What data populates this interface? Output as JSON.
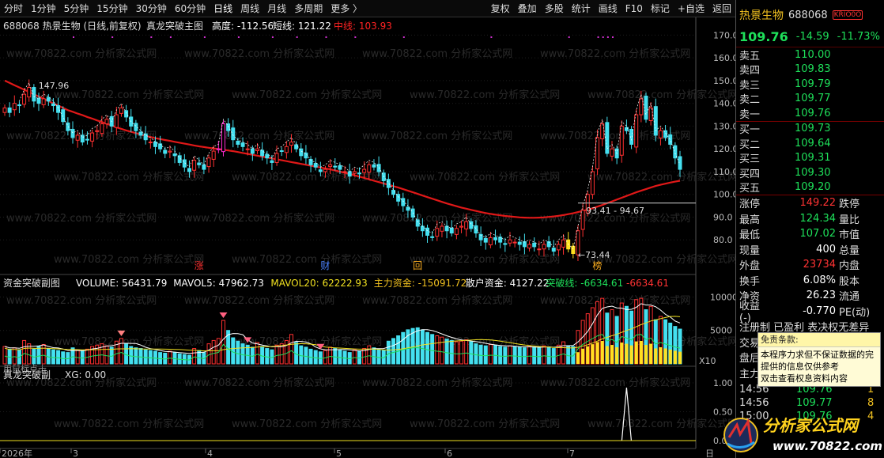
{
  "toolbar": {
    "left": [
      "分时",
      "1分钟",
      "5分钟",
      "15分钟",
      "30分钟",
      "60分钟",
      "日线",
      "周线",
      "月线",
      "多周期",
      "更多 〉"
    ],
    "active": "日线",
    "right": [
      "复权",
      "叠加",
      "多股",
      "统计",
      "画线",
      "F10",
      "标记",
      "+自选",
      "返回"
    ]
  },
  "main": {
    "title": "688068 热景生物 (日线,前复权)",
    "indicator": "真龙突破主图",
    "vals": [
      {
        "k": "高度",
        "v": "-112.56",
        "color": "#ffffff"
      },
      {
        "k": "短线",
        "v": "121.22",
        "color": "#ffffff"
      },
      {
        "k": "中线",
        "v": "103.93",
        "color": "#ff2222"
      }
    ],
    "y_ticks": [
      "170.0",
      "160.0",
      "150.0",
      "140.0",
      "130.0",
      "120.0",
      "110.0",
      "100.0",
      "90.0",
      "80.0"
    ],
    "labels": {
      "high": "147.96",
      "low": "73.44",
      "mid1": "93.41",
      "mid2": "94.67"
    },
    "markers": [
      "涨",
      "财",
      "回",
      "榜"
    ]
  },
  "sub1": {
    "title": "资金突破副图",
    "vals": [
      {
        "k": "VOLUME",
        "v": "56431.79",
        "color": "#ffffff"
      },
      {
        "k": "MAVOL5",
        "v": "47962.73",
        "color": "#ffffff"
      },
      {
        "k": "MAVOL20",
        "v": "62222.93",
        "color": "#f0e020"
      },
      {
        "k": "主力资金",
        "v": "-15091.72",
        "color": "#f0c020"
      },
      {
        "k": "散户资金",
        "v": "4127.22",
        "color": "#ffffff"
      },
      {
        "k": "突破线",
        "v": "-6634.61",
        "color": "#1ee05a"
      },
      {
        "k": "",
        "v": "-6634.61",
        "color": "#ff3333"
      }
    ],
    "y_ticks": [
      "10000",
      "5000",
      "X10"
    ],
    "corner": "用鼠标点击"
  },
  "sub2": {
    "title": "真龙突破副",
    "val": "XG: 0.00",
    "y_ticks": [
      "1.00",
      "0.50",
      "0.00"
    ]
  },
  "xaxis": {
    "labels": [
      "2026年",
      "3",
      "4",
      "5",
      "6",
      "7"
    ],
    "right": "日"
  },
  "watermark": "www.70822.com 分析家公式网",
  "chart_data": {
    "type": "candlestick",
    "closes": [
      138,
      136,
      140,
      139,
      144,
      147,
      141,
      140,
      142,
      141,
      139,
      136,
      132,
      128,
      125,
      126,
      123,
      124,
      127,
      128,
      131,
      133,
      130,
      135,
      138,
      134,
      130,
      128,
      126,
      124,
      123,
      121,
      120,
      118,
      119,
      117,
      114,
      112,
      110,
      115,
      113,
      111,
      116,
      119,
      120,
      131,
      128,
      124,
      122,
      121,
      120,
      118,
      120,
      117,
      116,
      114,
      118,
      119,
      121,
      123,
      120,
      117,
      116,
      113,
      112,
      110,
      111,
      113,
      112,
      111,
      110,
      108,
      110,
      109,
      111,
      113,
      112,
      110,
      106,
      103,
      100,
      97,
      95,
      93,
      90,
      86,
      84,
      82,
      81,
      85,
      86,
      84,
      83,
      85,
      86,
      88,
      85,
      83,
      80,
      79,
      81,
      80,
      79,
      78,
      80,
      79,
      78,
      77,
      78,
      77,
      76,
      78,
      77,
      75,
      78,
      80,
      76,
      74,
      84,
      93,
      100,
      110,
      125,
      131,
      118,
      120,
      116,
      130,
      128,
      122,
      135,
      142,
      133,
      138,
      126,
      128,
      125,
      122,
      116,
      111
    ],
    "ma_mid": [
      150,
      149,
      148,
      147,
      146,
      145,
      144,
      143,
      142,
      141,
      140,
      139,
      138,
      137,
      136.3,
      135.5,
      134.8,
      134,
      133.3,
      132.5,
      131.8,
      131,
      130.3,
      129.5,
      128.8,
      128.1,
      127.5,
      126.9,
      126.3,
      125.7,
      125.2,
      124.7,
      124.3,
      123.9,
      123.5,
      123.1,
      122.7,
      122.3,
      121.9,
      121.5,
      121.1,
      120.8,
      120.5,
      120.2,
      119.9,
      119.6,
      119.3,
      119,
      118.6,
      118.2,
      117.8,
      117.4,
      117,
      116.6,
      116.2,
      115.8,
      115.4,
      115,
      114.6,
      114.2,
      113.8,
      113.4,
      113,
      112.6,
      112.2,
      111.8,
      111.4,
      111,
      110.5,
      110,
      109.5,
      109,
      108.4,
      107.8,
      107.2,
      106.6,
      106,
      105.4,
      104.8,
      104.2,
      103.6,
      103,
      102.3,
      101.6,
      100.9,
      100.2,
      99.5,
      98.8,
      98.1,
      97.4,
      96.7,
      96,
      95.4,
      94.8,
      94.2,
      93.7,
      93.2,
      92.7,
      92.2,
      91.8,
      91.4,
      91.1,
      90.8,
      90.5,
      90.3,
      90.1,
      89.9,
      89.8,
      89.7,
      89.7,
      89.8,
      89.9,
      90.1,
      90.3,
      90.6,
      90.9,
      91.3,
      91.7,
      92.2,
      92.7,
      93.3,
      93.9,
      94.6,
      95.3,
      96.1,
      96.9,
      97.7,
      98.5,
      99.3,
      100.1,
      100.9,
      101.6,
      102.3,
      103,
      103.7,
      104.2,
      104.7,
      105.2,
      105.6,
      106
    ],
    "volume": [
      2600,
      2200,
      2400,
      2100,
      3500,
      3000,
      2200,
      2600,
      2900,
      2300,
      2100,
      2000,
      1800,
      1700,
      2400,
      2100,
      1900,
      2200,
      2600,
      2800,
      3000,
      2700,
      2500,
      3400,
      3800,
      3000,
      2600,
      2400,
      2300,
      2100,
      2000,
      1900,
      1700,
      1600,
      1900,
      1700,
      1500,
      1400,
      1300,
      2300,
      2000,
      1700,
      3000,
      3500,
      3800,
      6500,
      5000,
      3900,
      3400,
      3000,
      2800,
      2500,
      3200,
      2600,
      2300,
      2100,
      2800,
      3000,
      3500,
      4400,
      3200,
      2700,
      2500,
      2200,
      2000,
      1800,
      2000,
      2500,
      2300,
      2100,
      1900,
      1700,
      2100,
      1900,
      2300,
      2700,
      2400,
      2100,
      2000,
      3400,
      3800,
      4200,
      4700,
      5100,
      5300,
      5400,
      5100,
      4700,
      4400,
      4200,
      4000,
      3700,
      3500,
      3300,
      3400,
      3600,
      3300,
      3000,
      2800,
      2700,
      2900,
      2800,
      2600,
      2500,
      2700,
      2600,
      2500,
      2400,
      2600,
      2500,
      2400,
      2700,
      2500,
      2300,
      2800,
      3300,
      2700,
      2600,
      5000,
      6500,
      7500,
      8400,
      9300,
      9800,
      7600,
      8100,
      7100,
      9100,
      8600,
      7900,
      9600,
      9800,
      8100,
      8600,
      6600,
      7100,
      6600,
      6100,
      5600,
      5200
    ],
    "xg_signal_index": 128
  }
}
